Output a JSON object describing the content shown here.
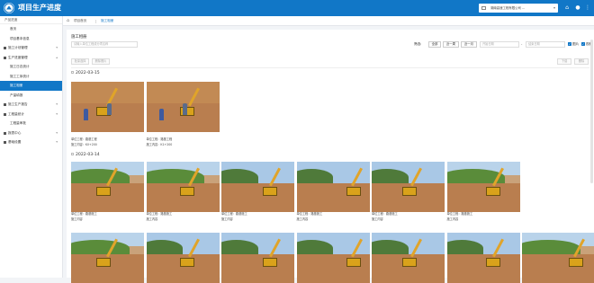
{
  "header": {
    "title": "项目生产进度",
    "org_select": "湖南高速工程有限公司 ...",
    "icons": [
      "home-icon",
      "user-icon",
      "menu-icon"
    ]
  },
  "sidebar": {
    "head": "产品进度",
    "items": [
      {
        "label": "首页",
        "top": false
      },
      {
        "label": "项目基本信息",
        "top": false
      },
      {
        "label": "施工计划管理",
        "top": true,
        "arrow": "▾"
      },
      {
        "label": "生产进度管理",
        "top": true,
        "arrow": "▴"
      },
      {
        "label": "施工日志统计",
        "top": false
      },
      {
        "label": "施工工序统计",
        "top": false
      },
      {
        "label": "施工相册",
        "top": false,
        "active": true
      },
      {
        "label": "产量填报",
        "top": false
      },
      {
        "label": "施工生产报告",
        "top": true,
        "arrow": "▾"
      },
      {
        "label": "工程量统计",
        "top": true,
        "arrow": "▾"
      },
      {
        "label": "工程量审批",
        "top": false
      },
      {
        "label": "报表中心",
        "top": true,
        "arrow": "▾"
      },
      {
        "label": "基础设置",
        "top": true,
        "arrow": "▾"
      }
    ]
  },
  "breadcrumb": {
    "items": [
      "项目首页",
      "施工相册"
    ]
  },
  "main": {
    "section_title": "施工相册",
    "search_placeholder": "请输入单位工程或分项名称",
    "filter_label": "筛选:",
    "filters": [
      "全部",
      "近一周",
      "近一月"
    ],
    "date_start_placeholder": "开始日期",
    "date_end_placeholder": "结束日期",
    "dash": "-",
    "checkbox_labels": [
      "图片",
      "视频"
    ],
    "toolbar_left": [
      "批量选择",
      "删除照片"
    ],
    "toolbar_right": [
      "下载",
      "删除"
    ]
  },
  "groups": [
    {
      "date": "2022-03-15",
      "photos": [
        {
          "caption1": "单位工程：路基工程",
          "caption2": "施工内容：K0+200",
          "style": "soil"
        },
        {
          "caption1": "单位工程：路基工程",
          "caption2": "施工内容：K1+200",
          "style": "soil"
        }
      ]
    },
    {
      "date": "2022-03-14",
      "photos": [
        {
          "caption1": "单位工程：路基施工",
          "caption2": "施工内容",
          "style": "green"
        },
        {
          "caption1": "单位工程：路基施工",
          "caption2": "施工内容",
          "style": "green"
        },
        {
          "caption1": "单位工程：路基施工",
          "caption2": "施工内容",
          "style": "sky2"
        },
        {
          "caption1": "单位工程：路基施工",
          "caption2": "施工内容",
          "style": "sky2"
        },
        {
          "caption1": "单位工程：路基施工",
          "caption2": "施工内容",
          "style": "sky2"
        },
        {
          "caption1": "单位工程：路基施工",
          "caption2": "施工内容",
          "style": "green"
        }
      ]
    },
    {
      "date": "",
      "photos": [
        {
          "caption1": "",
          "caption2": "",
          "style": "green"
        },
        {
          "caption1": "",
          "caption2": "",
          "style": "sky2"
        },
        {
          "caption1": "",
          "caption2": "",
          "style": "sky2"
        },
        {
          "caption1": "",
          "caption2": "",
          "style": "sky2"
        },
        {
          "caption1": "",
          "caption2": "",
          "style": "sky2"
        },
        {
          "caption1": "",
          "caption2": "",
          "style": "sky2"
        },
        {
          "caption1": "",
          "caption2": "",
          "style": "green"
        }
      ]
    }
  ],
  "colors": {
    "accent": "#1177c7",
    "header_bg": "#1177c7"
  }
}
